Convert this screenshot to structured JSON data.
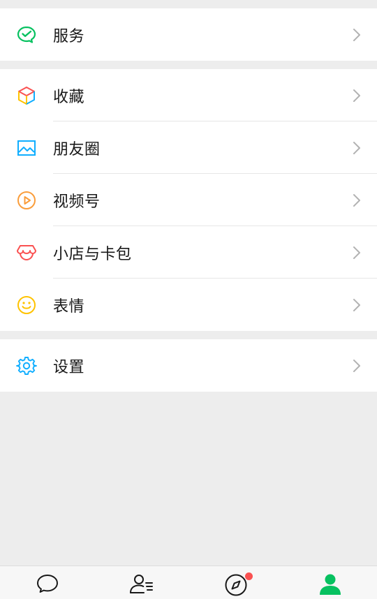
{
  "colors": {
    "background": "#ededed",
    "card": "#ffffff",
    "accent_green": "#07c160",
    "badge_red": "#fa5151",
    "chevron": "#b2b2b2"
  },
  "groups": [
    {
      "items": [
        {
          "label": "服务",
          "icon": "wechat-pay-icon"
        }
      ]
    },
    {
      "items": [
        {
          "label": "收藏",
          "icon": "cube-icon"
        },
        {
          "label": "朋友圈",
          "icon": "image-icon"
        },
        {
          "label": "视频号",
          "icon": "play-icon"
        },
        {
          "label": "小店与卡包",
          "icon": "shop-icon"
        },
        {
          "label": "表情",
          "icon": "smiley-icon"
        }
      ]
    },
    {
      "items": [
        {
          "label": "设置",
          "icon": "gear-icon"
        }
      ]
    }
  ],
  "tabbar": {
    "tabs": [
      {
        "icon": "chat-icon",
        "active": false
      },
      {
        "icon": "contacts-icon",
        "active": false
      },
      {
        "icon": "compass-icon",
        "active": false,
        "badge": true
      },
      {
        "icon": "me-icon",
        "active": true
      }
    ]
  }
}
